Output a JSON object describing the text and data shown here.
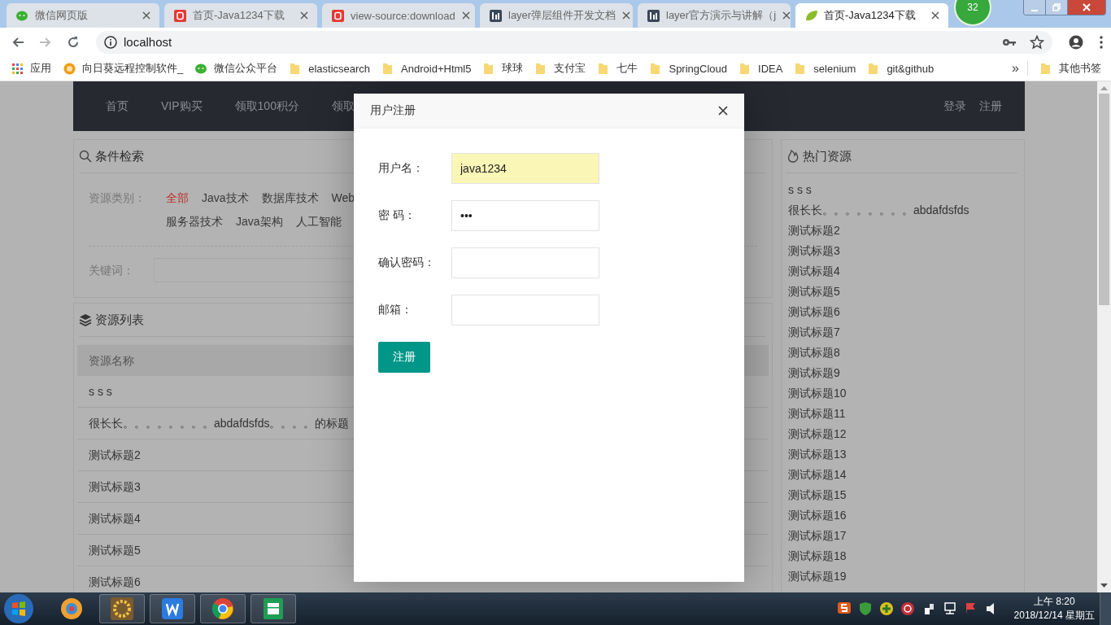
{
  "browser": {
    "tabs": [
      {
        "title": "微信网页版",
        "kind": "wechat",
        "selected": false
      },
      {
        "title": "首页-Java1234下载",
        "kind": "site",
        "selected": false
      },
      {
        "title": "view-source:download",
        "kind": "site",
        "selected": false
      },
      {
        "title": "layer弹层组件开发文档",
        "kind": "layer",
        "selected": false
      },
      {
        "title": "layer官方演示与讲解（j",
        "kind": "layer",
        "selected": false
      },
      {
        "title": "首页-Java1234下载",
        "kind": "leaf",
        "selected": true
      }
    ],
    "badge": "32",
    "address": "localhost",
    "bookmarks": [
      {
        "label": "应用",
        "kind": "apps"
      },
      {
        "label": "向日葵远程控制软件_",
        "kind": "sunflower"
      },
      {
        "label": "微信公众平台",
        "kind": "wechat"
      },
      {
        "label": "elasticsearch",
        "kind": "folder"
      },
      {
        "label": "Android+Html5",
        "kind": "folder"
      },
      {
        "label": "球球",
        "kind": "folder"
      },
      {
        "label": "支付宝",
        "kind": "folder"
      },
      {
        "label": "七牛",
        "kind": "folder"
      },
      {
        "label": "SpringCloud",
        "kind": "folder"
      },
      {
        "label": "IDEA",
        "kind": "folder"
      },
      {
        "label": "selenium",
        "kind": "folder"
      },
      {
        "label": "git&github",
        "kind": "folder"
      }
    ],
    "bookmarks_overflow": "»",
    "other_bookmarks": "其他书签"
  },
  "nav": {
    "left": [
      "首页",
      "VIP购买",
      "领取100积分",
      "领取"
    ],
    "right": [
      "登录",
      "注册"
    ]
  },
  "search_panel": {
    "title": "条件检索",
    "category_label": "资源类别：",
    "category_rows": [
      [
        {
          "label": "全部",
          "selected": true
        },
        {
          "label": "Java技术",
          "selected": false
        },
        {
          "label": "数据库技术",
          "selected": false
        },
        {
          "label": "Web",
          "selected": false
        }
      ],
      [
        {
          "label": "服务器技术",
          "selected": false
        },
        {
          "label": "Java架构",
          "selected": false
        },
        {
          "label": "人工智能",
          "selected": false
        }
      ]
    ],
    "keyword_label": "关键词："
  },
  "resource_list": {
    "title": "资源列表",
    "column_1": "资源名称",
    "rows": [
      "s s s",
      "很长长。。。。。。。。abdafdsfds。。。。的标题",
      "测试标题2",
      "测试标题3",
      "测试标题4",
      "测试标题5",
      "测试标题6"
    ]
  },
  "hot_resources": {
    "title": "热门资源",
    "items": [
      "s s s",
      "很长长。。。。。。。。abdafdsfds",
      "测试标题2",
      "测试标题3",
      "测试标题4",
      "测试标题5",
      "测试标题6",
      "测试标题7",
      "测试标题8",
      "测试标题9",
      "测试标题10",
      "测试标题11",
      "测试标题12",
      "测试标题13",
      "测试标题14",
      "测试标题15",
      "测试标题16",
      "测试标题17",
      "测试标题18",
      "测试标题19"
    ]
  },
  "dialog": {
    "title": "用户注册",
    "fields": [
      {
        "label": "用户名：",
        "value": "java1234",
        "autofilled": true
      },
      {
        "label": "密 码：",
        "value": "•••",
        "autofilled": false
      },
      {
        "label": "确认密码：",
        "autofilled": false
      },
      {
        "label": "邮箱：",
        "autofilled": false
      }
    ],
    "submit": "注册"
  },
  "taskbar": {
    "time": "上午 8:20",
    "date": "2018/12/14 星期五"
  }
}
